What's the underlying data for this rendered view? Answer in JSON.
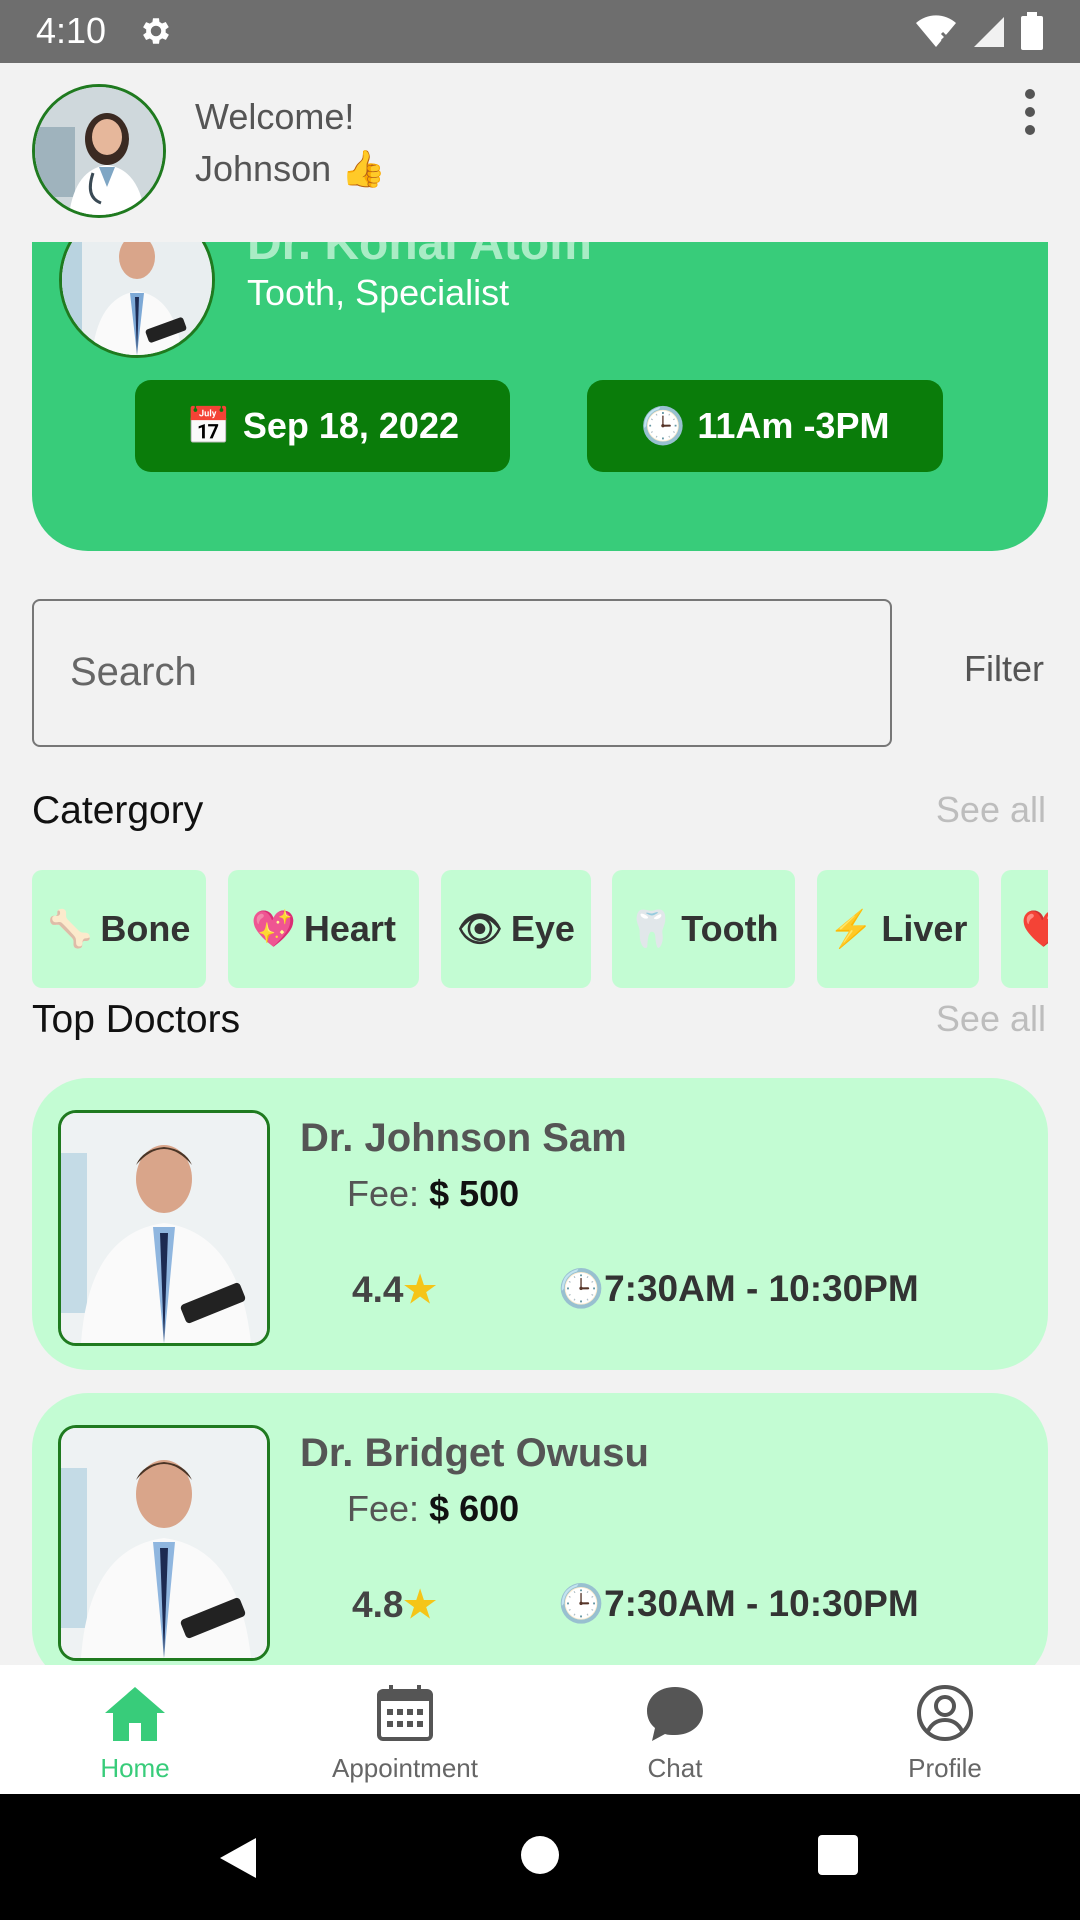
{
  "status_bar": {
    "time": "4:10"
  },
  "header": {
    "welcome": "Welcome!",
    "user_name": "Johnson 👍"
  },
  "appointment": {
    "doctor_name": "Dr. Kohal Atom",
    "specialty": "Tooth, Specialist",
    "date_icon": "📅",
    "date": "Sep 18, 2022",
    "time_icon": "🕒",
    "time": "11Am -3PM"
  },
  "search": {
    "placeholder": "Search",
    "filter_label": "Filter"
  },
  "category_section": {
    "title": "Catergory",
    "see_all": "See all"
  },
  "categories": [
    {
      "icon": "🦴",
      "label": "Bone"
    },
    {
      "icon": "💖",
      "label": "Heart"
    },
    {
      "icon": "👁",
      "label": "Eye"
    },
    {
      "icon": "🦷",
      "label": "Tooth"
    },
    {
      "icon": "⚡",
      "label": "Liver"
    },
    {
      "icon": "❤️",
      "label": ""
    }
  ],
  "doctors_section": {
    "title": "Top Doctors",
    "see_all": "See all"
  },
  "doctors": [
    {
      "name": "Dr. Johnson Sam",
      "fee_label": "Fee:",
      "fee": "$ 500",
      "rating": "4.4",
      "hours": "7:30AM - 10:30PM"
    },
    {
      "name": "Dr. Bridget Owusu",
      "fee_label": "Fee:",
      "fee": "$ 600",
      "rating": "4.8",
      "hours": "7:30AM - 10:30PM"
    }
  ],
  "bottom_nav": [
    {
      "label": "Home",
      "icon": "home-icon",
      "active": true
    },
    {
      "label": "Appointment",
      "icon": "calendar-icon",
      "active": false
    },
    {
      "label": "Chat",
      "icon": "chat-icon",
      "active": false
    },
    {
      "label": "Profile",
      "icon": "profile-icon",
      "active": false
    }
  ],
  "colors": {
    "accent": "#38cc7a",
    "dark_green": "#0a7c0a",
    "card_bg": "#c3fcd3"
  }
}
